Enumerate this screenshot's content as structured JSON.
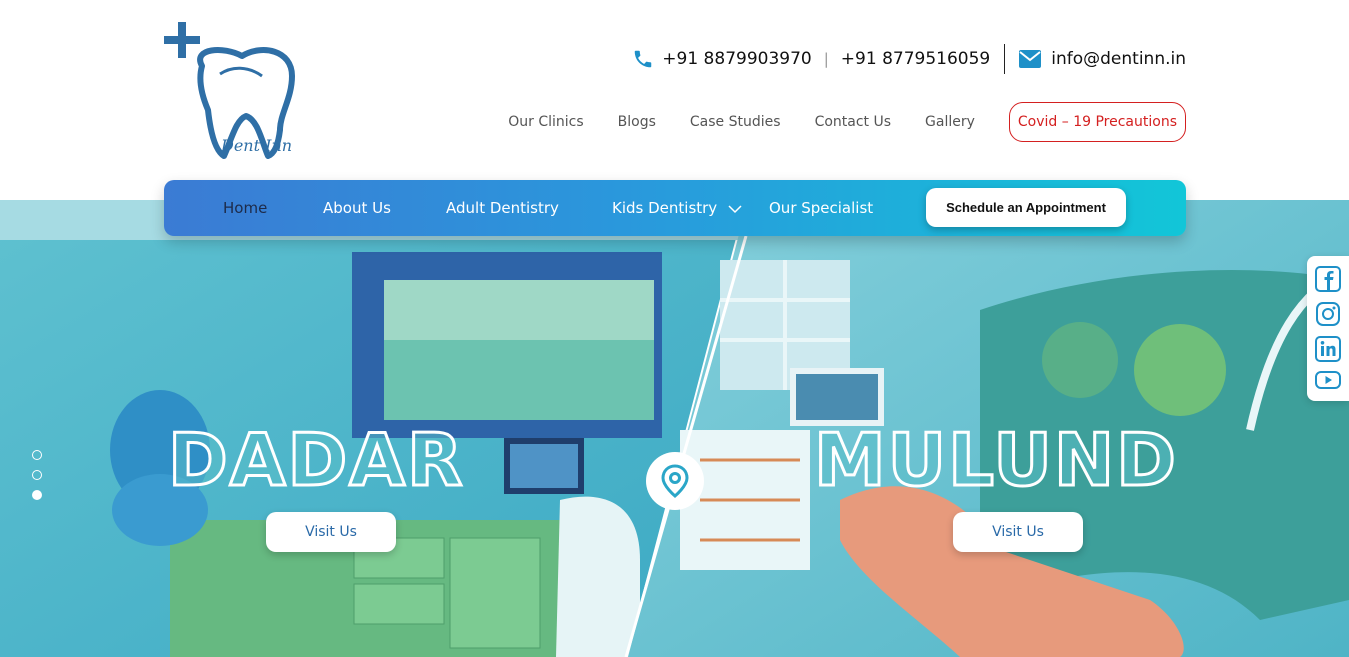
{
  "brand": {
    "logo_text": "Dent Inn"
  },
  "contact": {
    "phone1": "+91 8879903970",
    "separator": "|",
    "phone2": "+91 8779516059",
    "email": "info@dentinn.in"
  },
  "top_nav": {
    "items": [
      "Our Clinics",
      "Blogs",
      "Case Studies",
      "Contact Us",
      "Gallery"
    ],
    "covid_label": "Covid – 19 Precautions"
  },
  "main_nav": {
    "items": [
      "Home",
      "About Us",
      "Adult Dentistry",
      "Kids Dentistry",
      "Our Specialist"
    ],
    "cta_label": "Schedule an Appointment"
  },
  "hero": {
    "left_city": "DADAR",
    "right_city": "MULUND",
    "visit_label": "Visit Us",
    "slide_count": 3,
    "active_slide": 3
  },
  "social": [
    "facebook-icon",
    "instagram-icon",
    "linkedin-icon",
    "youtube-icon"
  ],
  "colors": {
    "brand_blue": "#2f6fa6",
    "nav_start": "#3b7bd4",
    "nav_end": "#12c6d8",
    "covid_red": "#d42020",
    "overlay": "#2aa6c8"
  }
}
